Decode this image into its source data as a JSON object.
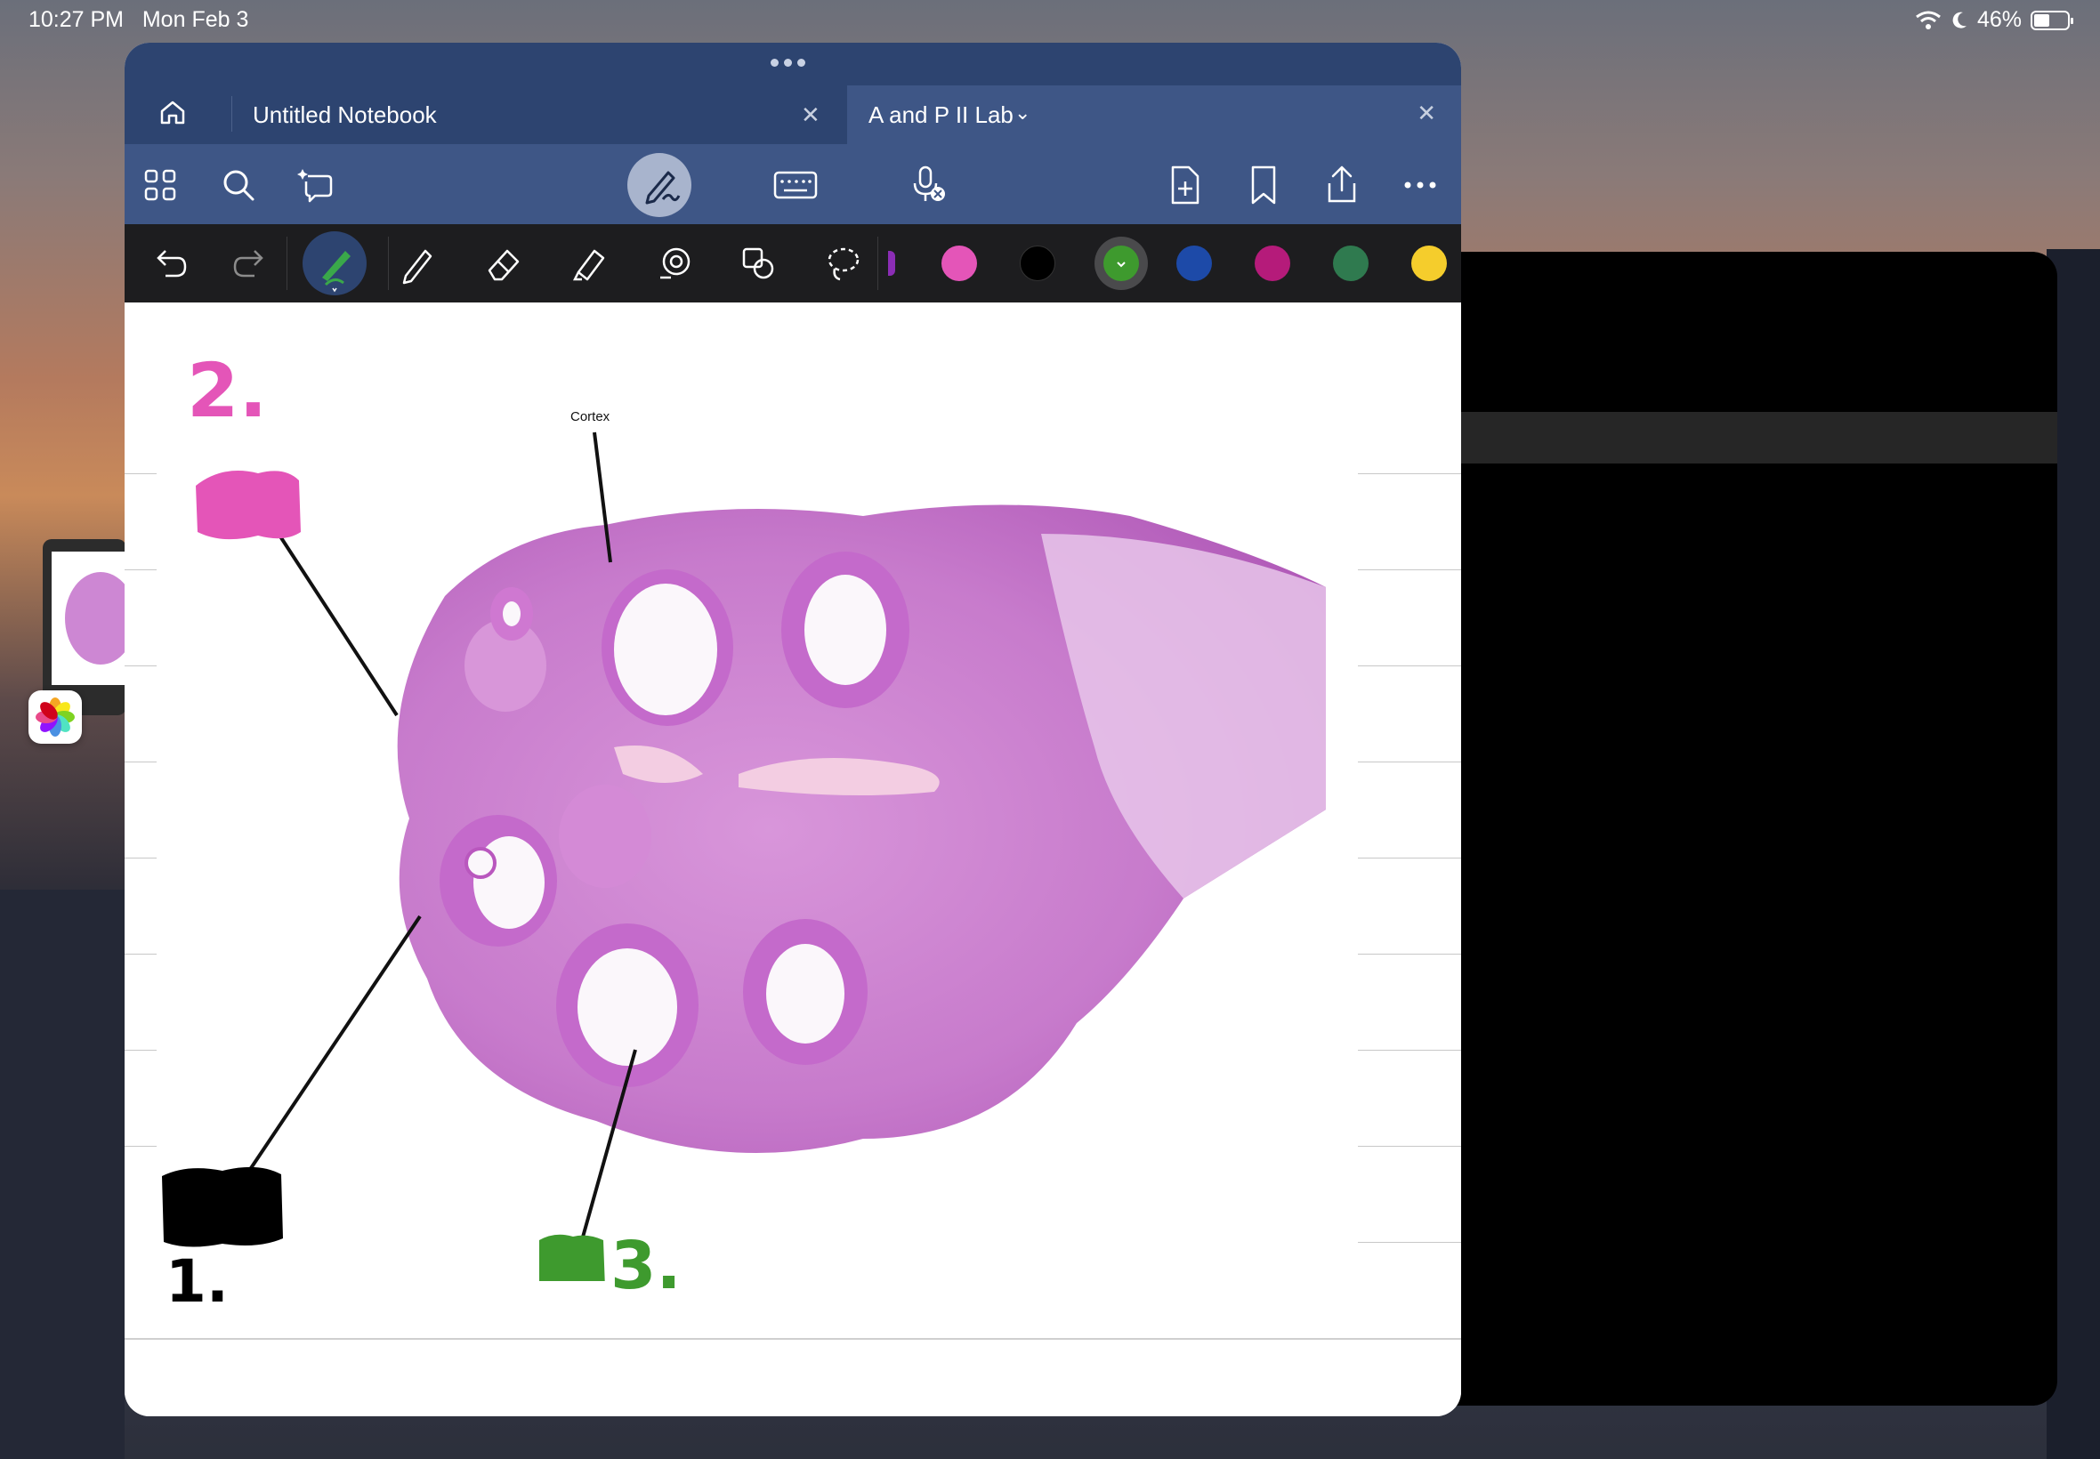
{
  "status_bar": {
    "time": "10:27 PM",
    "date": "Mon Feb 3",
    "battery_text": "46%",
    "battery_level": 0.46
  },
  "tabs": [
    {
      "label": "Untitled Notebook",
      "active": false
    },
    {
      "label": "A and P II Lab",
      "active": true
    }
  ],
  "top_toolbar": {
    "left_icons": [
      "grid-icon",
      "search-icon",
      "lasso-ai-icon"
    ],
    "center_icons": [
      "pen-mode-icon",
      "keyboard-icon",
      "mic-off-icon"
    ],
    "right_icons": [
      "add-page-icon",
      "bookmark-icon",
      "share-icon",
      "more-icon"
    ]
  },
  "drawing_toolbar": {
    "tools": [
      "undo-icon",
      "redo-icon",
      "pen-active-icon",
      "pencil-icon",
      "eraser-icon",
      "highlighter-icon",
      "shape-icon",
      "elements-icon",
      "lasso-icon"
    ],
    "colors": [
      "#e455b8",
      "#000000",
      "#3e9a2e",
      "#1d4aa8",
      "#b51b7a",
      "#2f7a4f",
      "#f5cd2c"
    ],
    "selected_color": "#3e9a2e"
  },
  "page": {
    "label_cortex": "Cortex",
    "annotations": [
      "2.",
      "1.",
      "3."
    ]
  },
  "colors": {
    "title_bar": "#2d4470",
    "toolbar": "#3e5686",
    "drawing_bar": "#1d1d1f",
    "pink_ink": "#e455b8",
    "green_ink": "#3e9a2e"
  }
}
